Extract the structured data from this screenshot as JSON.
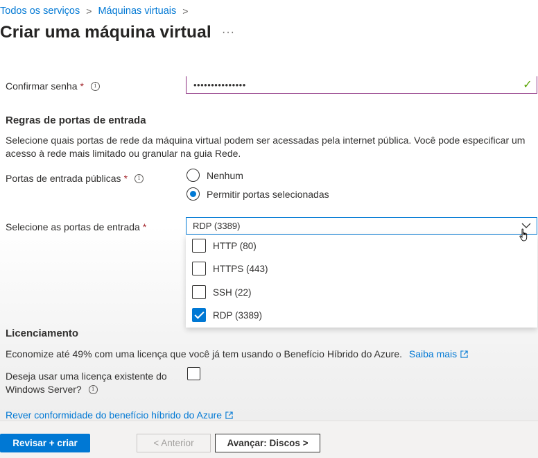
{
  "breadcrumb": {
    "items": [
      "Todos os serviços",
      "Máquinas virtuais"
    ],
    "separator": ">"
  },
  "page": {
    "title": "Criar uma máquina virtual",
    "more_label": "···"
  },
  "confirm_password": {
    "label": "Confirmar senha",
    "required": "*",
    "value": "•••••••••••••••",
    "status": "✓"
  },
  "inbound_rules": {
    "heading": "Regras de portas de entrada",
    "description": "Selecione quais portas de rede da máquina virtual podem ser acessadas pela internet pública. Você pode especificar um acesso à rede mais limitado ou granular na guia Rede.",
    "public_ports": {
      "label": "Portas de entrada públicas",
      "required": "*",
      "options": [
        "Nenhum",
        "Permitir portas selecionadas"
      ],
      "selected": "Permitir portas selecionadas"
    },
    "select_ports": {
      "label": "Selecione as portas de entrada",
      "required": "*",
      "value": "RDP (3389)",
      "options": [
        {
          "label": "HTTP (80)",
          "checked": false
        },
        {
          "label": "HTTPS (443)",
          "checked": false
        },
        {
          "label": "SSH (22)",
          "checked": false
        },
        {
          "label": "RDP (3389)",
          "checked": true
        }
      ]
    }
  },
  "licensing": {
    "heading": "Licenciamento",
    "description": "Economize até 49% com uma licença que você já tem usando o Benefício Híbrido do Azure.",
    "learn_more": "Saiba mais",
    "existing_license_label_line1": "Deseja usar uma licença existente do",
    "existing_license_label_line2": "Windows Server?",
    "existing_license_checked": false,
    "review_link": "Rever conformidade do benefício híbrido do Azure"
  },
  "footer": {
    "review_create": "Revisar + criar",
    "previous": "< Anterior",
    "next": "Avançar: Discos >"
  },
  "colors": {
    "accent": "#0078d4",
    "required": "#a4262c",
    "valid": "#57a300",
    "password_border": "#8a2c7f"
  }
}
